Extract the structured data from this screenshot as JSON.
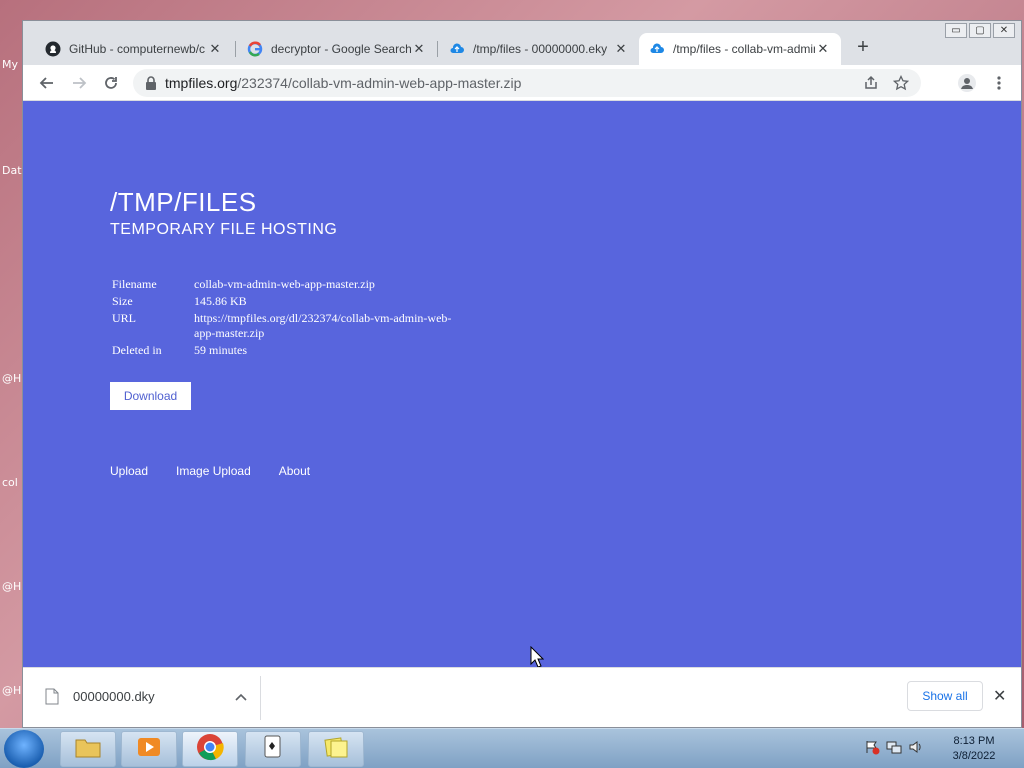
{
  "desktop": {
    "labels": [
      "My",
      "Dat",
      "@H",
      "col",
      "@H",
      "@H"
    ]
  },
  "window": {
    "controls": [
      "▭",
      "▢",
      "✕"
    ]
  },
  "tabs": [
    {
      "label": "GitHub - computernewb/c",
      "icon": "github-icon"
    },
    {
      "label": "decryptor - Google Search",
      "icon": "google-icon"
    },
    {
      "label": "/tmp/files - 00000000.eky",
      "icon": "cloud-upload-icon"
    },
    {
      "label": "/tmp/files - collab-vm-admin",
      "icon": "cloud-upload-icon",
      "active": true
    }
  ],
  "toolbar": {
    "url_host": "tmpfiles.org",
    "url_path": "/232374/collab-vm-admin-web-app-master.zip"
  },
  "page": {
    "title": "/TMP/FILES",
    "subtitle": "TEMPORARY FILE HOSTING",
    "info": {
      "filename_label": "Filename",
      "filename_value": "collab-vm-admin-web-app-master.zip",
      "size_label": "Size",
      "size_value": "145.86 KB",
      "url_label": "URL",
      "url_value": "https://tmpfiles.org/dl/232374/collab-vm-admin-web-app-master.zip",
      "deleted_label": "Deleted in",
      "deleted_value": "59 minutes"
    },
    "download_label": "Download",
    "footer": {
      "upload": "Upload",
      "image_upload": "Image Upload",
      "about": "About"
    },
    "background": "#5865dd"
  },
  "download_bar": {
    "filename": "00000000.dky",
    "show_all": "Show all"
  },
  "taskbar": {
    "time": "8:13 PM",
    "date": "3/8/2022"
  }
}
